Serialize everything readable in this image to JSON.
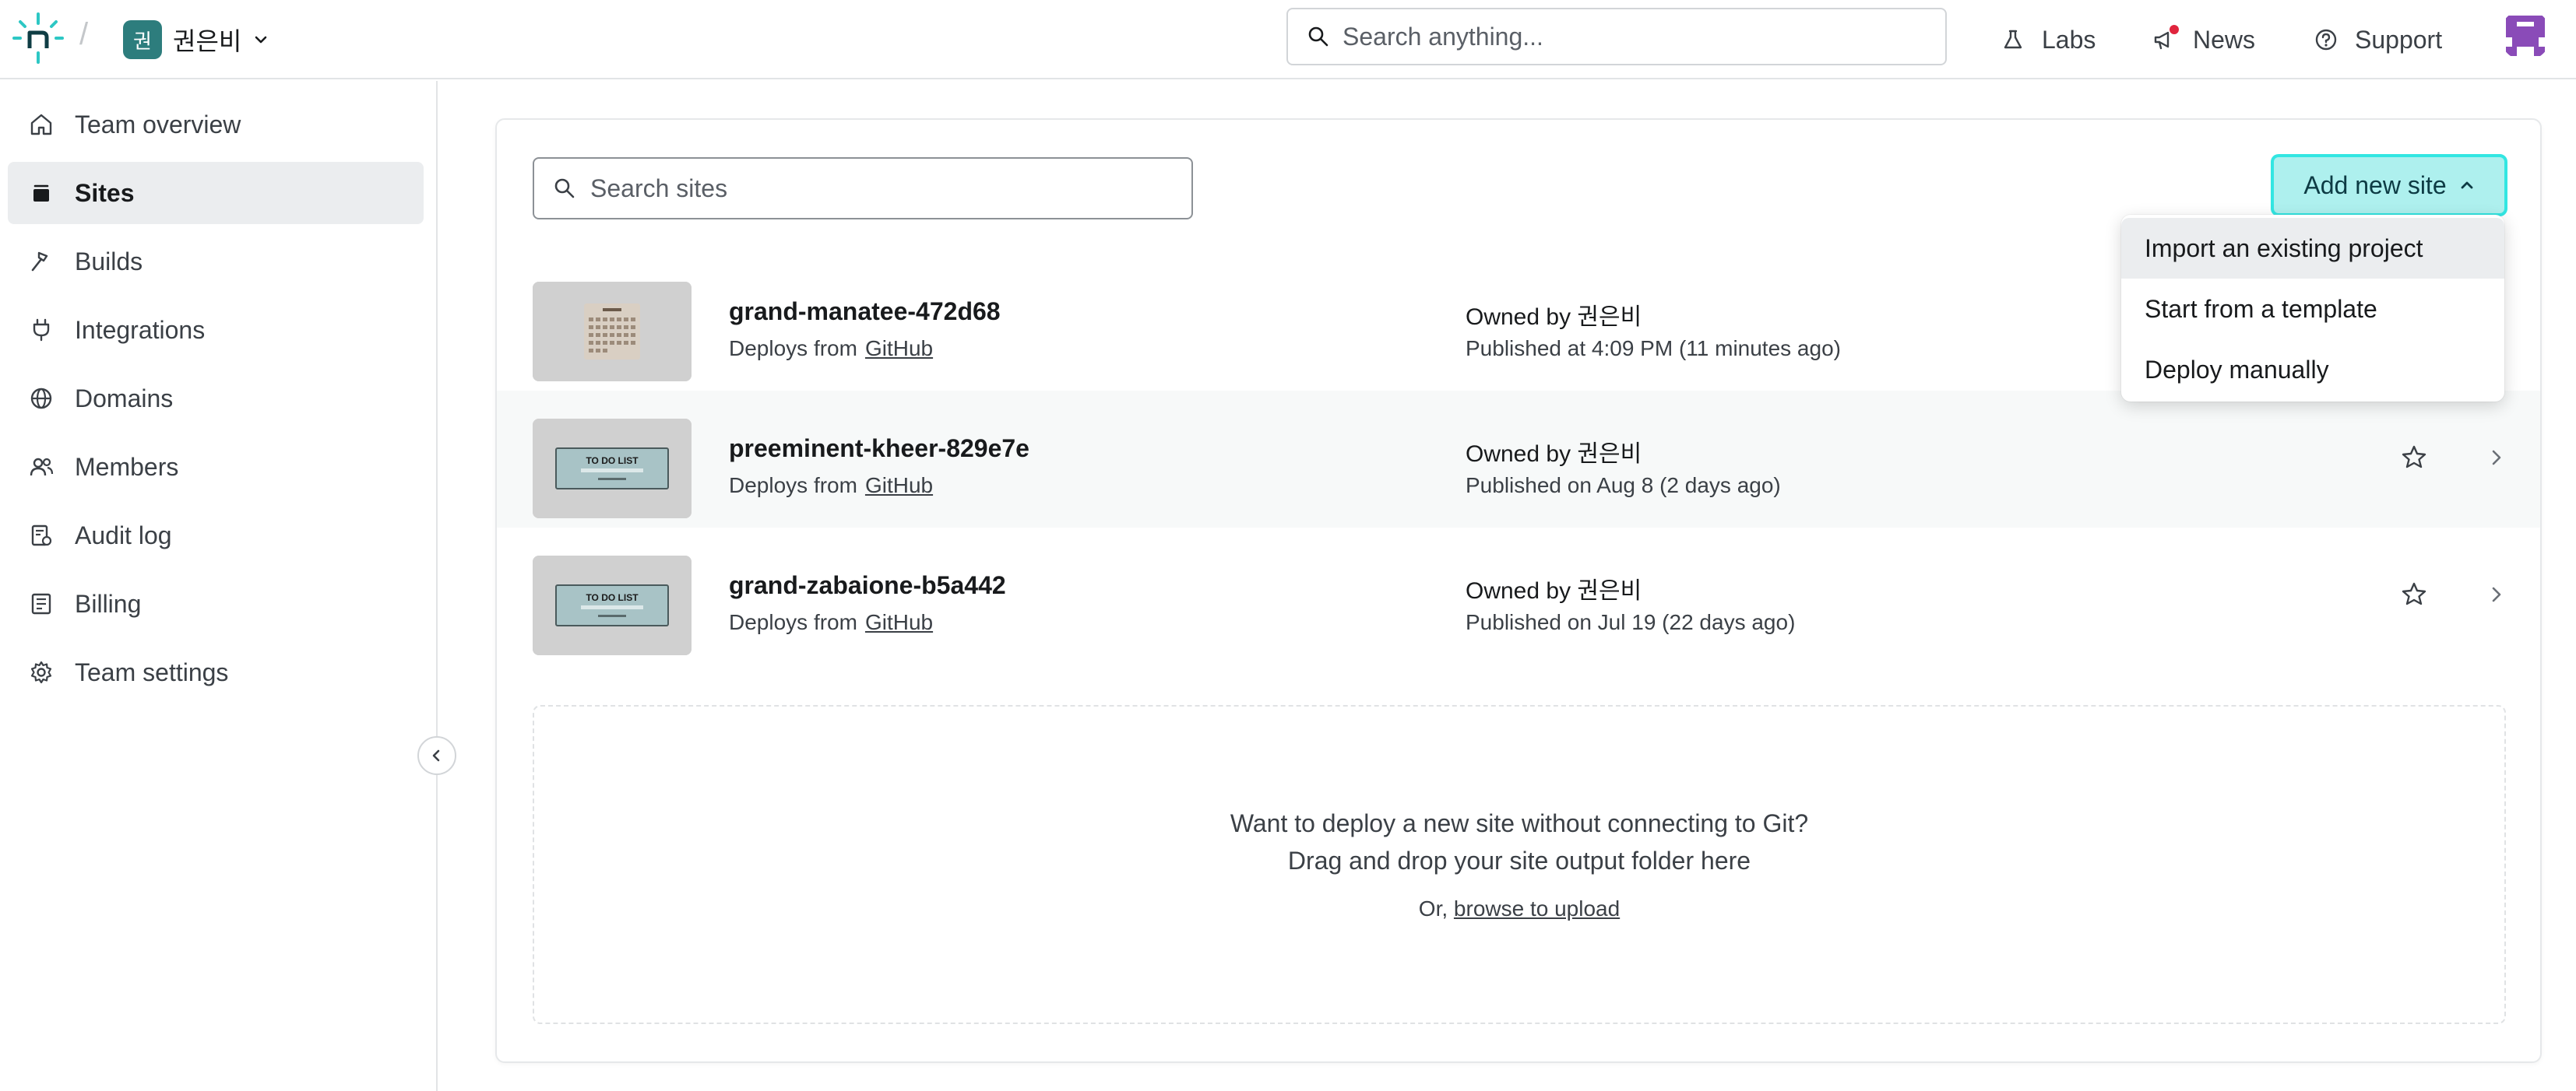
{
  "header": {
    "team_badge": "권",
    "team_name": "권은비",
    "search_placeholder": "Search anything...",
    "links": {
      "labs": "Labs",
      "news": "News",
      "support": "Support"
    }
  },
  "sidebar": {
    "items": [
      {
        "label": "Team overview",
        "icon": "home-icon"
      },
      {
        "label": "Sites",
        "icon": "sites-stack-icon",
        "active": true
      },
      {
        "label": "Builds",
        "icon": "hammer-icon"
      },
      {
        "label": "Integrations",
        "icon": "plug-icon"
      },
      {
        "label": "Domains",
        "icon": "globe-icon"
      },
      {
        "label": "Members",
        "icon": "members-icon"
      },
      {
        "label": "Audit log",
        "icon": "audit-log-icon"
      },
      {
        "label": "Billing",
        "icon": "billing-icon"
      },
      {
        "label": "Team settings",
        "icon": "gear-icon"
      }
    ]
  },
  "main": {
    "search_placeholder": "Search sites",
    "add_button_label": "Add new site",
    "dropdown": [
      "Import an existing project",
      "Start from a template",
      "Deploy manually"
    ],
    "sites": [
      {
        "name": "grand-manatee-472d68",
        "deploys_from_label": "Deploys from",
        "provider": "GitHub",
        "owner": "Owned by 권은비",
        "published": "Published at 4:09 PM (11 minutes ago)",
        "thumb": "calendar"
      },
      {
        "name": "preeminent-kheer-829e7e",
        "deploys_from_label": "Deploys from",
        "provider": "GitHub",
        "owner": "Owned by 권은비",
        "published": "Published on Aug 8 (2 days ago)",
        "thumb": "todo",
        "thumb_text": "TO DO LIST"
      },
      {
        "name": "grand-zabaione-b5a442",
        "deploys_from_label": "Deploys from",
        "provider": "GitHub",
        "owner": "Owned by 권은비",
        "published": "Published on Jul 19 (22 days ago)",
        "thumb": "todo",
        "thumb_text": "TO DO LIST"
      }
    ],
    "dropzone": {
      "line1": "Want to deploy a new site without connecting to Git?",
      "line2": "Drag and drop your site output folder here",
      "or_label": "Or,",
      "upload_link": "browse to upload"
    }
  },
  "colors": {
    "accent_bg": "#aef0ee",
    "accent_border": "#32e6e2",
    "logo_teal": "#2dc7c4",
    "team_badge": "#2d7d7d",
    "news_dot": "#e0243d"
  }
}
